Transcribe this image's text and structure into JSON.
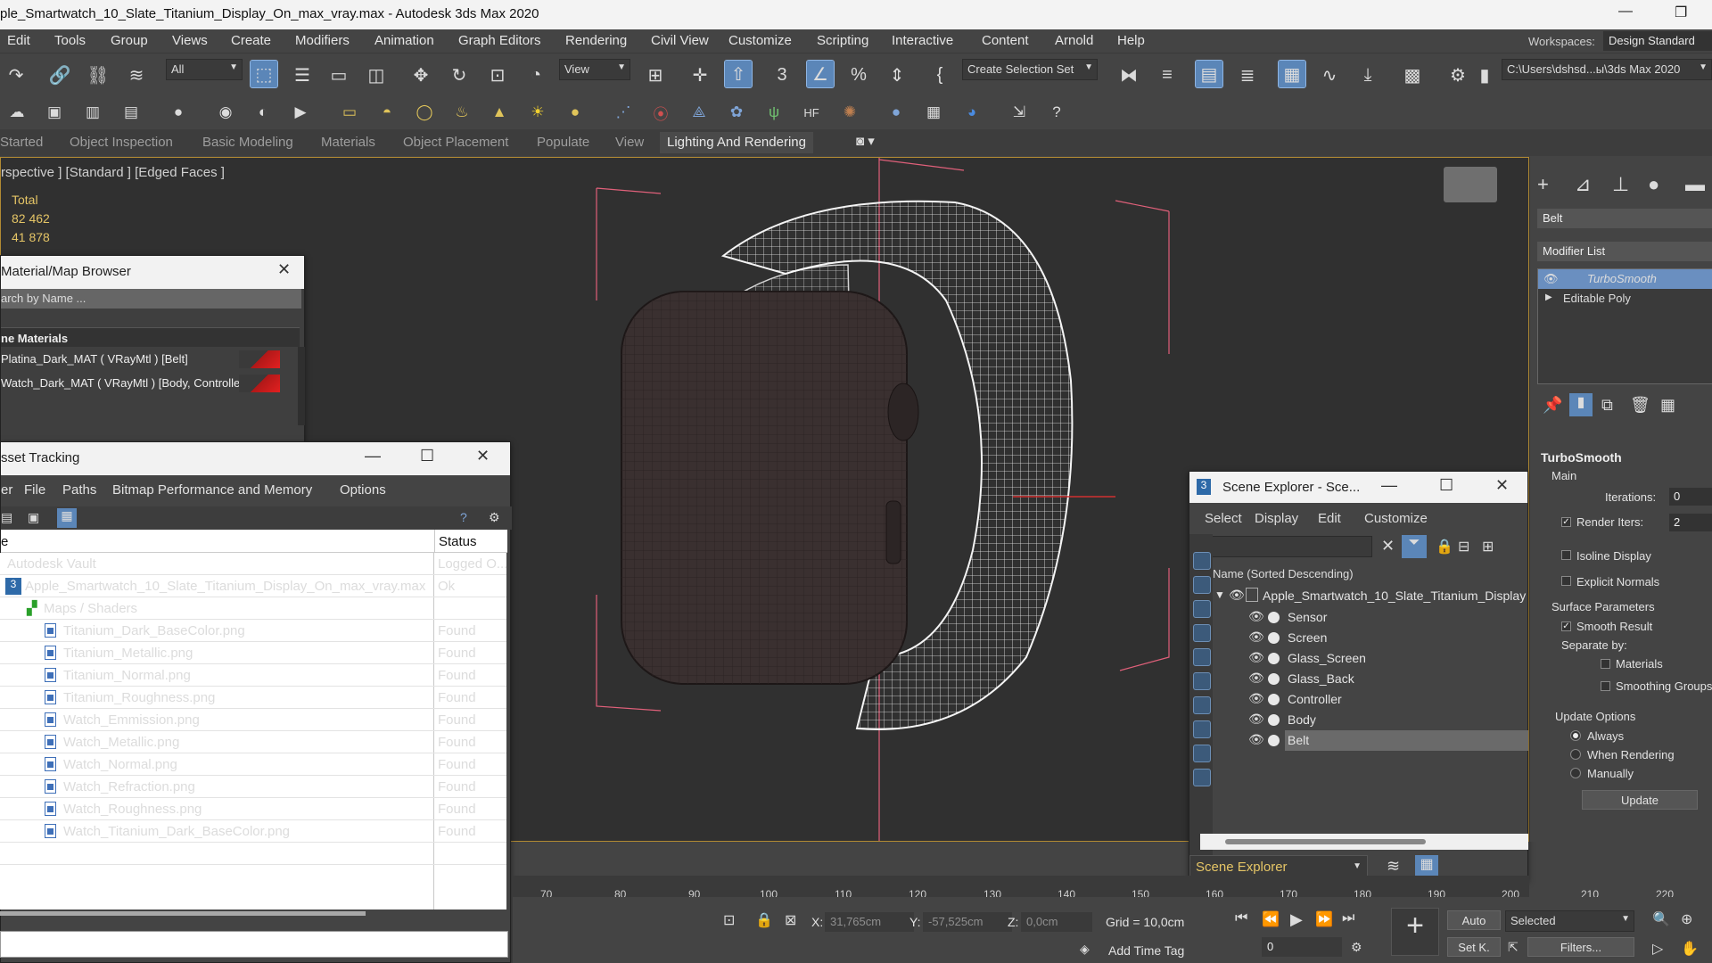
{
  "window": {
    "title": "ple_Smartwatch_10_Slate_Titanium_Display_On_max_vray.max - Autodesk 3ds Max 2020",
    "minimize": "—",
    "restore": "❐"
  },
  "menu": {
    "items": [
      "Edit",
      "Tools",
      "Group",
      "Views",
      "Create",
      "Modifiers",
      "Animation",
      "Graph Editors",
      "Rendering",
      "Civil View",
      "Customize",
      "Scripting",
      "Interactive",
      "Content",
      "Arnold",
      "Help"
    ],
    "workspaces_label": "Workspaces:",
    "workspace_value": "Design Standard"
  },
  "toolbar": {
    "selection_filter": "All",
    "reference_coord": "View",
    "named_selection": "Create Selection Set",
    "project_path": "C:\\Users\\dshsd...ы\\3ds Max 2020"
  },
  "ribbon": {
    "tabs": [
      "Started",
      "Object Inspection",
      "Basic Modeling",
      "Materials",
      "Object Placement",
      "Populate",
      "View",
      "Lighting And Rendering"
    ],
    "active_index": 7
  },
  "viewport": {
    "label": "rspective ] [Standard ] [Edged Faces ]",
    "stats_total_label": "Total",
    "stats_polys": "82 462",
    "stats_verts": "41 878",
    "frame_color": "#b18a33"
  },
  "material_browser": {
    "title": "Material/Map Browser",
    "search_placeholder": "arch by Name ...",
    "group_label": "ne Materials",
    "rows": [
      "Platina_Dark_MAT  ( VRayMtl )  [Belt]",
      "Watch_Dark_MAT  ( VRayMtl )  [Body, Controller..."
    ]
  },
  "asset_tracking": {
    "title": "sset Tracking",
    "menu": [
      "er",
      "File",
      "Paths",
      "Bitmap Performance and Memory",
      "Options"
    ],
    "col_name": "e",
    "col_status": "Status",
    "rows": [
      {
        "name": "Autodesk Vault",
        "status": "Logged O..."
      },
      {
        "name": "Apple_Smartwatch_10_Slate_Titanium_Display_On_max_vray.max",
        "status": "Ok"
      },
      {
        "name": "Maps / Shaders",
        "status": ""
      },
      {
        "name": "Titanium_Dark_BaseColor.png",
        "status": "Found"
      },
      {
        "name": "Titanium_Metallic.png",
        "status": "Found"
      },
      {
        "name": "Titanium_Normal.png",
        "status": "Found"
      },
      {
        "name": "Titanium_Roughness.png",
        "status": "Found"
      },
      {
        "name": "Watch_Emmission.png",
        "status": "Found"
      },
      {
        "name": "Watch_Metallic.png",
        "status": "Found"
      },
      {
        "name": "Watch_Normal.png",
        "status": "Found"
      },
      {
        "name": "Watch_Refraction.png",
        "status": "Found"
      },
      {
        "name": "Watch_Roughness.png",
        "status": "Found"
      },
      {
        "name": "Watch_Titanium_Dark_BaseColor.png",
        "status": "Found"
      }
    ]
  },
  "scene_explorer": {
    "title": "Scene Explorer - Sce...",
    "menu": [
      "Select",
      "Display",
      "Edit",
      "Customize"
    ],
    "column_header": "Name (Sorted Descending)",
    "root": "Apple_Smartwatch_10_Slate_Titanium_Display",
    "objects": [
      "Sensor",
      "Screen",
      "Glass_Screen",
      "Glass_Back",
      "Controller",
      "Body",
      "Belt"
    ],
    "selected": "Belt",
    "footer_dropdown": "Scene Explorer"
  },
  "command_panel": {
    "object_name": "Belt",
    "modifier_list": "Modifier List",
    "stack": [
      "TurboSmooth",
      "Editable Poly"
    ],
    "rollout_title": "TurboSmooth",
    "main_label": "Main",
    "iterations_label": "Iterations:",
    "iterations_value": "0",
    "render_iters_label": "Render Iters:",
    "render_iters_value": "2",
    "isoline_label": "Isoline Display",
    "explicit_normals_label": "Explicit Normals",
    "surface_params_label": "Surface Parameters",
    "smooth_result_label": "Smooth Result",
    "separate_by_label": "Separate by:",
    "materials_label": "Materials",
    "smoothing_groups_label": "Smoothing Groups",
    "update_options_label": "Update Options",
    "always_label": "Always",
    "when_rendering_label": "When Rendering",
    "manually_label": "Manually",
    "update_button": "Update"
  },
  "timeline": {
    "ticks": [
      "70",
      "80",
      "90",
      "100",
      "110",
      "120",
      "130",
      "140",
      "150",
      "160",
      "170",
      "180",
      "190",
      "200",
      "210",
      "220"
    ]
  },
  "status": {
    "x_label": "X:",
    "x_value": "31,765cm",
    "y_label": "Y:",
    "y_value": "-57,525cm",
    "z_label": "Z:",
    "z_value": "0,0cm",
    "grid": "Grid = 10,0cm",
    "add_time_tag": "Add Time Tag",
    "auto": "Auto",
    "selected": "Selected",
    "set_key": "Set K.",
    "filters": "Filters...",
    "frame": "0"
  },
  "colors": {
    "accent_blue": "#5b86b8",
    "stats_yellow": "#e5c566",
    "selected_row": "#6a6a6a",
    "material_red": "#e32020"
  }
}
